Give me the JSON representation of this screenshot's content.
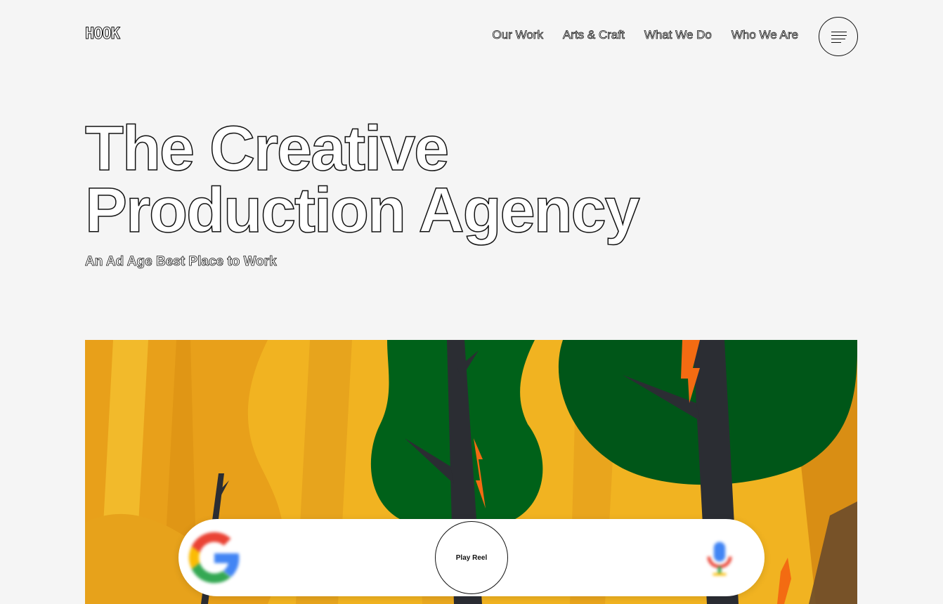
{
  "brand": {
    "logo_text": "HOOK"
  },
  "nav": {
    "items": [
      {
        "label": "Our Work"
      },
      {
        "label": "Arts & Craft"
      },
      {
        "label": "What We Do"
      },
      {
        "label": "Who We Are"
      }
    ],
    "menu_icon": "hamburger-menu-icon"
  },
  "hero": {
    "title_line1": "The Creative",
    "title_line2": "Production Agency",
    "subtitle": "An Ad Age Best Place to Work"
  },
  "reel": {
    "play_label": "Play Reel",
    "search_left_icon": "google-g-icon",
    "search_right_icon": "microphone-icon"
  },
  "colors": {
    "background": "#f5f5f5",
    "forest_yellow": "#f1b321",
    "tree_green": "#006119",
    "trunk_dark": "#2b2d33",
    "flame_orange": "#f36b12"
  }
}
